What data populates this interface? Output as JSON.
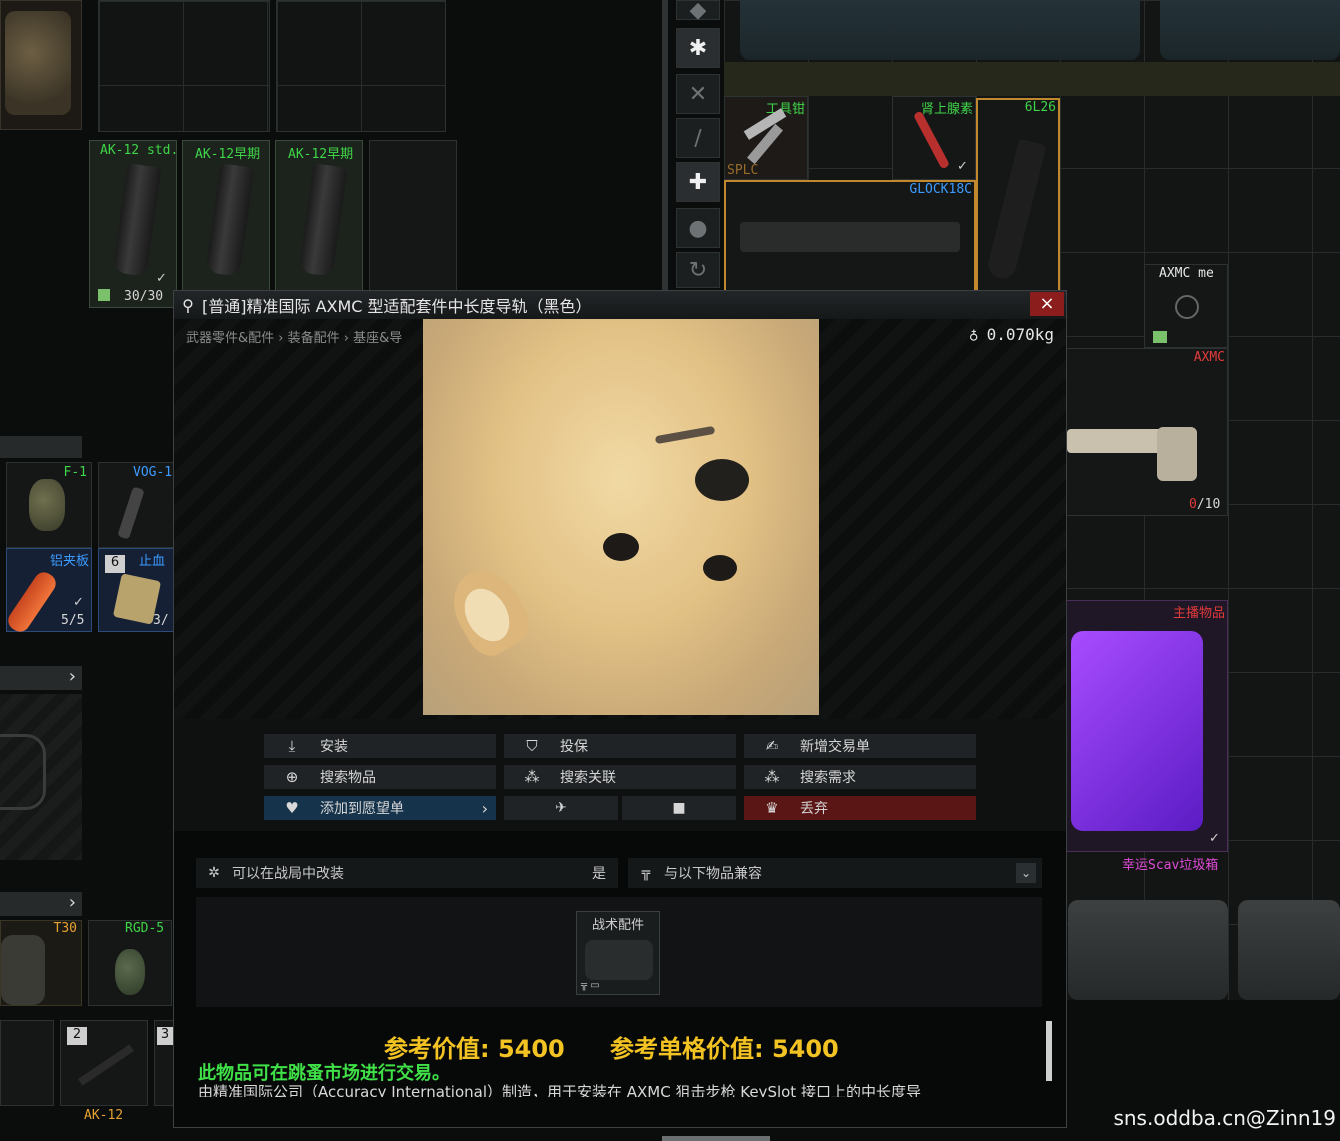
{
  "inventory": {
    "mags": [
      {
        "label": "AK-12 std.",
        "count": "30/30"
      },
      {
        "label": "AK-12早期"
      },
      {
        "label": "AK-12早期"
      }
    ],
    "f1": "F-1",
    "vog": "VOG-1",
    "splint": {
      "label": "铝夹板",
      "count": "5/5"
    },
    "hemo": {
      "label": "止血",
      "count": "3/",
      "badge": "6"
    },
    "t30": "T30",
    "rgd": "RGD-5",
    "ak12": {
      "label": "AK-12",
      "badge": "2",
      "badge2": "3"
    }
  },
  "stash": {
    "tool": "工具钳",
    "tool_tag": "SPLC",
    "adrenaline": "肾上腺素",
    "mag6l26": "6L26",
    "glock": "GLOCK18C",
    "axmc_me": "AXMC me",
    "axmc": "AXMC",
    "axmc_count_red": "0",
    "axmc_count": "/10",
    "streamer": "主播物品",
    "lucky": "幸运Scav垃圾箱"
  },
  "dialog": {
    "title": "[普通]精准国际 AXMC 型适配套件中长度导轨（黑色）",
    "close": "×",
    "breadcrumb": "武器零件&配件 › 装备配件 › 基座&导",
    "weight": "0.070kg",
    "actions": {
      "install": "安装",
      "insure": "投保",
      "new_offer": "新增交易单",
      "search_item": "搜索物品",
      "search_related": "搜索关联",
      "search_need": "搜索需求",
      "wishlist": "添加到愿望单",
      "discard": "丢弃"
    },
    "modifiable_label": "可以在战局中改装",
    "modifiable_value": "是",
    "compatible_label": "与以下物品兼容",
    "compat_item": "战术配件",
    "price_ref": "参考价值: 5400",
    "price_slot": "参考单格价值: 5400",
    "flea": "此物品可在跳蚤市场进行交易。",
    "description": "由精准国际公司（Accuracy International）制造，用于安装在 AXMC 狙击步枪 KeySlot 接口上的中长度导"
  },
  "watermark": "sns.oddba.cn@Zinn19"
}
